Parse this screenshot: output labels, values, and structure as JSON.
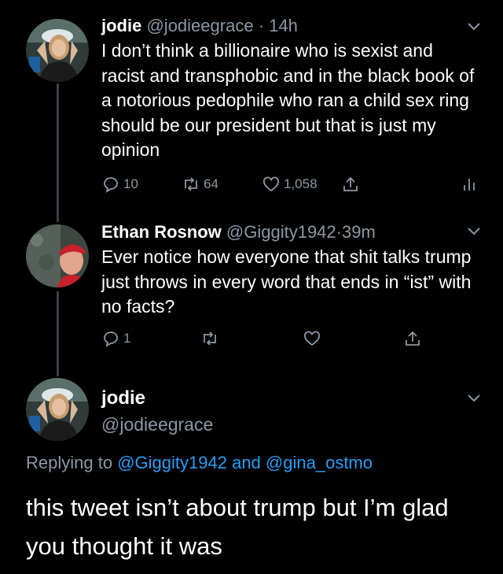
{
  "tweets": [
    {
      "name": "jodie",
      "handle": "@jodieegrace",
      "sep": "·",
      "time": "14h",
      "text": "I don’t think a billionaire who is sexist and racist and transphobic and in the black book of a notorious pedophile who ran a child sex ring should be our president but that is just my opinion",
      "replies": "10",
      "retweets": "64",
      "likes": "1,058"
    },
    {
      "name": "Ethan Rosnow",
      "handle": "@Giggity1942",
      "sep": "·",
      "time": "39m",
      "text": "Ever notice how everyone that shit talks trump just throws in every word that ends in “ist” with no facts?",
      "replies": "1"
    }
  ],
  "main_tweet": {
    "name": "jodie",
    "handle": "@jodieegrace",
    "replying_prefix": "Replying to",
    "replying_to_1": "@Giggity1942",
    "replying_and": "and",
    "replying_to_2": "@gina_ostmo",
    "text": "this tweet isn’t about trump but I’m glad you thought it was"
  },
  "colors": {
    "background": "#000000",
    "secondary_text": "#8b98a5",
    "link": "#2a9df4",
    "thread_line": "#3a4047"
  },
  "icons": [
    "reply-icon",
    "retweet-icon",
    "like-icon",
    "share-icon",
    "analytics-icon",
    "chevron-down-icon"
  ]
}
